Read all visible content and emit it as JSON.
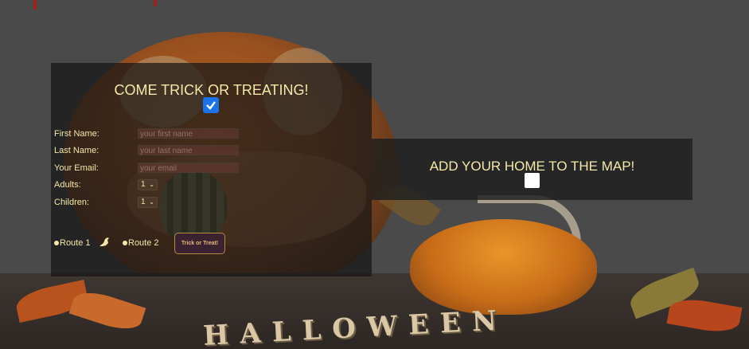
{
  "form": {
    "title": "COME TRICK OR TREATING!",
    "checkbox_checked": true,
    "fields": [
      {
        "label": "First Name:",
        "placeholder": "your first name"
      },
      {
        "label": "Last Name:",
        "placeholder": "your last name"
      },
      {
        "label": "Your Email:",
        "placeholder": "your email"
      }
    ],
    "adults": {
      "label": "Adults:",
      "value": "1"
    },
    "children": {
      "label": "Children:",
      "value": "1"
    },
    "routes": [
      "Route 1",
      "Route 2"
    ],
    "submit_label": "Trick or Treat!"
  },
  "map": {
    "title": "ADD YOUR HOME TO THE MAP!",
    "checkbox_checked": false
  },
  "background": {
    "text": "HALLOWEEN"
  },
  "colors": {
    "text": "#f5e8a8",
    "panel": "#161616",
    "checkbox": "#1a73e8"
  }
}
